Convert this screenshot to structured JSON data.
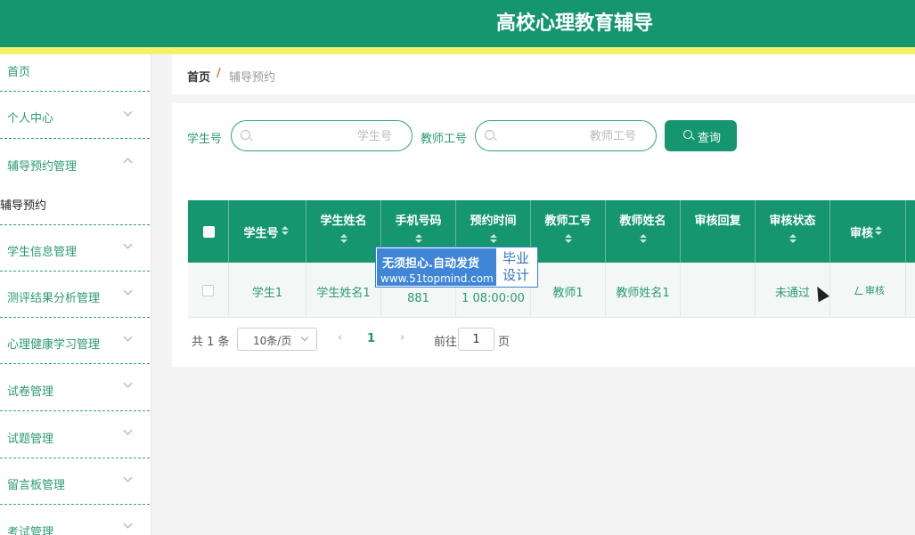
{
  "app": {
    "title": "高校心理教育辅导"
  },
  "colors": {
    "primary": "#15966f",
    "accent_stripe": "#f3f36a",
    "watermark_blue": "#3f86d8",
    "breadcrumb_sep": "#e0762c"
  },
  "sidebar": {
    "items": [
      {
        "label": "首页",
        "icon": "none"
      },
      {
        "label": "个人中心",
        "icon": "chevron-down-icon"
      },
      {
        "label": "辅导预约管理",
        "icon": "chevron-up-icon"
      },
      {
        "label": "学生信息管理",
        "icon": "chevron-down-icon"
      },
      {
        "label": "测评结果分析管理",
        "icon": "chevron-down-icon"
      },
      {
        "label": "心理健康学习管理",
        "icon": "chevron-down-icon"
      },
      {
        "label": "试卷管理",
        "icon": "chevron-down-icon"
      },
      {
        "label": "试题管理",
        "icon": "chevron-down-icon"
      },
      {
        "label": "留言板管理",
        "icon": "chevron-down-icon"
      },
      {
        "label": "考试管理",
        "icon": "chevron-down-icon"
      }
    ],
    "subitem": "辅导预约"
  },
  "breadcrumb": {
    "home": "首页",
    "separator": "/",
    "current": "辅导预约"
  },
  "search": {
    "student_label": "学生号",
    "student_placeholder": "学生号",
    "student_value": "",
    "teacher_label": "教师工号",
    "teacher_placeholder": "教师工号",
    "teacher_value": "",
    "query_label": "查询"
  },
  "table": {
    "headers": [
      "学生号",
      "学生姓名",
      "手机号码",
      "预约时间",
      "教师工号",
      "教师姓名",
      "审核回复",
      "审核状态",
      "审核"
    ],
    "rows": [
      {
        "student_no": "学生1",
        "student_name": "学生姓名1",
        "phone": "881",
        "time": "1 08:00:00",
        "teacher_no": "教师1",
        "teacher_name": "教师姓名1",
        "reply": "",
        "status": "未通过",
        "action": "审核"
      }
    ]
  },
  "pagination": {
    "total_text": "共 1 条",
    "page_size": "10条/页",
    "prev_icon": "‹",
    "current_page": "1",
    "next_icon": "›",
    "goto_label": "前往",
    "goto_value": "1",
    "page_word": "页"
  },
  "watermark": {
    "line1": "无须担心.自动发货",
    "line2": "www.51topmind.com",
    "side": "毕业设计"
  }
}
